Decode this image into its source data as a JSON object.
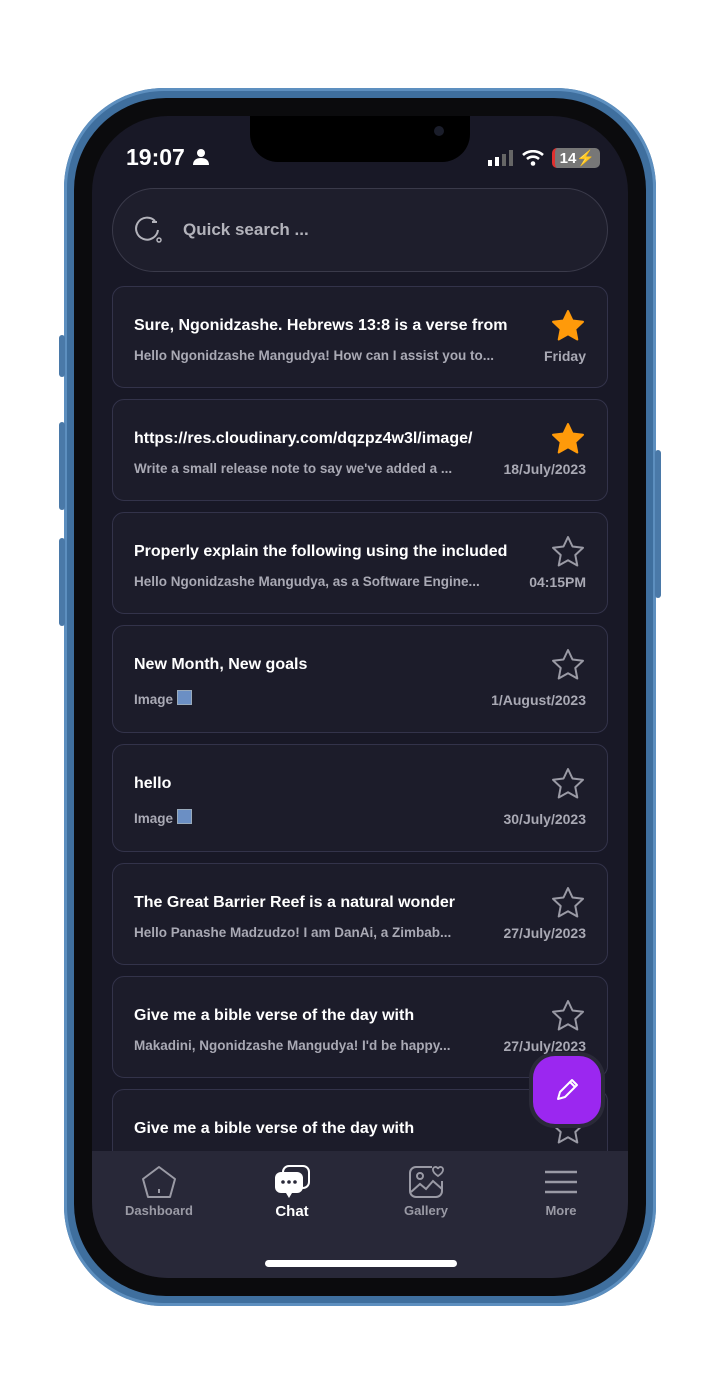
{
  "status_bar": {
    "time": "19:07",
    "battery": "14"
  },
  "search": {
    "placeholder": "Quick search ..."
  },
  "colors": {
    "accent": "#9b27f0",
    "star_active": "#ff9a0a",
    "background": "#181826"
  },
  "chats": [
    {
      "title": "Sure, Ngonidzashe. Hebrews 13:8 is a verse from",
      "preview": "Hello Ngonidzashe Mangudya! How can I assist you to...",
      "date": "Friday",
      "starred": true
    },
    {
      "title": "https://res.cloudinary.com/dqzpz4w3l/image/",
      "preview": "Write a small release note to say we've added a ...",
      "date": "18/July/2023",
      "starred": true
    },
    {
      "title": "Properly explain the following using the included",
      "preview": "Hello Ngonidzashe Mangudya, as a Software Engine...",
      "date": "04:15PM",
      "starred": false
    },
    {
      "title": "New Month, New goals",
      "preview": "Image",
      "date": "1/August/2023",
      "starred": false,
      "image": true
    },
    {
      "title": "hello",
      "preview": "Image",
      "date": "30/July/2023",
      "starred": false,
      "image": true
    },
    {
      "title": "The Great Barrier Reef is a natural wonder",
      "preview": "Hello Panashe Madzudzo! I am DanAi, a Zimbab...",
      "date": "27/July/2023",
      "starred": false
    },
    {
      "title": "Give me a bible verse of the day with",
      "preview": "Makadini, Ngonidzashe Mangudya! I'd be happy...",
      "date": "27/July/2023",
      "starred": false
    },
    {
      "title": "Give me a bible verse of the day with",
      "starred": false
    }
  ],
  "tabs": [
    {
      "label": "Dashboard",
      "icon": "home-icon"
    },
    {
      "label": "Chat",
      "icon": "chat-icon",
      "active": true
    },
    {
      "label": "Gallery",
      "icon": "gallery-icon"
    },
    {
      "label": "More",
      "icon": "menu-icon"
    }
  ]
}
